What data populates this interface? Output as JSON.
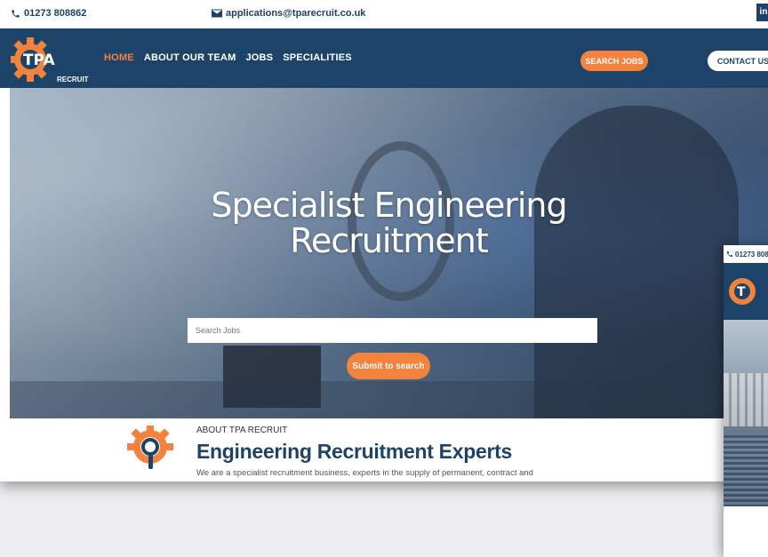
{
  "topbar": {
    "phone": "01273 808862",
    "email": "applications@tparecruit.co.uk",
    "social": "in"
  },
  "logo": {
    "text_main": "TPA",
    "text_sub": "RECRUIT"
  },
  "nav": {
    "items": [
      {
        "label": "HOME",
        "active": true
      },
      {
        "label": "ABOUT OUR TEAM",
        "active": false
      },
      {
        "label": "JOBS",
        "active": false
      },
      {
        "label": "SPECIALITIES",
        "active": false
      }
    ],
    "search_jobs": "SEARCH JOBS",
    "contact_us": "CONTACT US"
  },
  "hero": {
    "title_line1": "Specialist Engineering",
    "title_line2": "Recruitment",
    "search_placeholder": "Search Jobs",
    "submit_label": "Submit to search"
  },
  "about": {
    "kicker": "ABOUT TPA RECRUIT",
    "heading": "Engineering Recruitment Experts",
    "text": "We are a specialist recruitment business, experts in the supply of permanent, contract and"
  },
  "second_shot": {
    "phone": "01273 808"
  },
  "colors": {
    "navy": "#1d4468",
    "orange": "#f2823c",
    "white": "#ffffff"
  }
}
